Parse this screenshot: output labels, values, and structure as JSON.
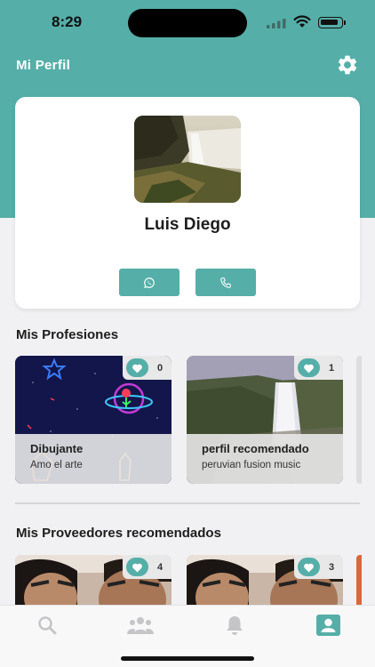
{
  "status_bar": {
    "time": "8:29"
  },
  "header": {
    "title": "Mi Perfil"
  },
  "profile": {
    "name": "Luis Diego"
  },
  "professions": {
    "title": "Mis Profesiones",
    "items": [
      {
        "title": "Dibujante",
        "subtitle": "Amo el arte",
        "likes": "0"
      },
      {
        "title": "perfil recomendado",
        "subtitle": "peruvian fusion music",
        "likes": "1"
      }
    ]
  },
  "providers": {
    "title": "Mis Proveedores recomendados",
    "items": [
      {
        "likes": "4"
      },
      {
        "likes": "3"
      }
    ]
  },
  "nav": {
    "items": [
      "search-icon",
      "group-icon",
      "bell-icon",
      "profile-icon"
    ],
    "active": "profile-icon"
  },
  "colors": {
    "accent": "#56aea8",
    "inactive_icon": "#c5c5c8"
  }
}
